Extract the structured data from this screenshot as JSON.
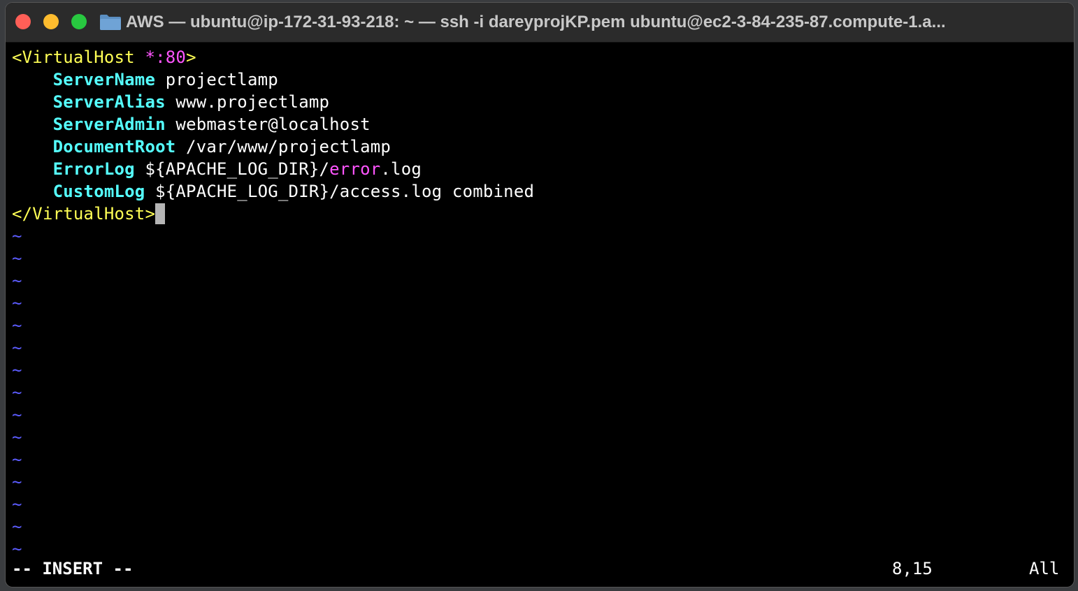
{
  "window": {
    "title": "AWS — ubuntu@ip-172-31-93-218: ~ — ssh -i dareyprojKP.pem ubuntu@ec2-3-84-235-87.compute-1.a..."
  },
  "editor": {
    "lines": [
      {
        "kind": "open-tag",
        "open": "<VirtualHost ",
        "addr": "*:80",
        "close": ">"
      },
      {
        "kind": "directive",
        "indent": "    ",
        "key": "ServerName",
        "rest": " projectlamp"
      },
      {
        "kind": "directive",
        "indent": "    ",
        "key": "ServerAlias",
        "rest": " www.projectlamp"
      },
      {
        "kind": "directive",
        "indent": "    ",
        "key": "ServerAdmin",
        "rest": " webmaster@localhost"
      },
      {
        "kind": "directive",
        "indent": "    ",
        "key": "DocumentRoot",
        "rest": " /var/www/projectlamp"
      },
      {
        "kind": "errorlog",
        "indent": "    ",
        "key": "ErrorLog",
        "pre": " ${APACHE_LOG_DIR}/",
        "hl": "error",
        "post": ".log"
      },
      {
        "kind": "directive",
        "indent": "    ",
        "key": "CustomLog",
        "rest": " ${APACHE_LOG_DIR}/access.log combined"
      },
      {
        "kind": "close-tag",
        "text": "</VirtualHost>"
      }
    ],
    "tilde_char": "~",
    "tilde_count": 15
  },
  "status": {
    "mode": "-- INSERT --",
    "position": "8,15",
    "scroll": "All"
  },
  "colors": {
    "tag": "#ffff55",
    "keyword": "#55ffff",
    "highlight": "#ff55ff",
    "tilde": "#5c5cff"
  }
}
